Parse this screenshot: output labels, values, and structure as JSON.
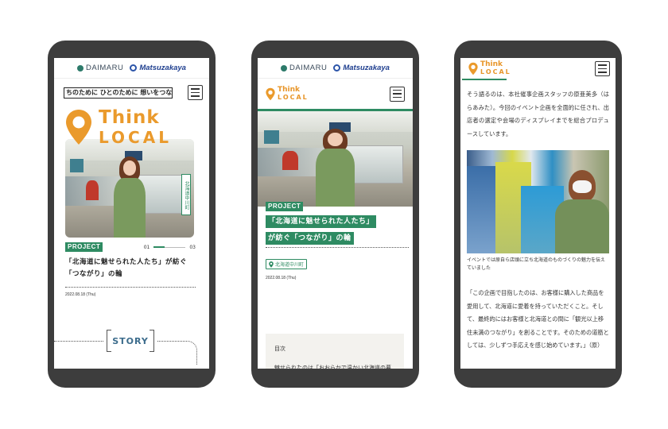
{
  "brand": {
    "daimaru": "DAIMARU",
    "matsuzakaya": "Matsuzakaya",
    "logo_line1": "Think",
    "logo_line2": "LOCAL"
  },
  "colors": {
    "accent_green": "#2e8b62",
    "logo_orange": "#ea9a2c",
    "story_blue": "#3c6c8c",
    "frame": "#3d3d3d"
  },
  "phone1": {
    "marquee": "ちのために ひとのために 想いをつな",
    "location_tag": "北海道中川町",
    "category": "PROJECT",
    "pager": {
      "current": "01",
      "total": "03",
      "progress": 0.33
    },
    "title": "「北海道に魅せられた人たち」が紡ぐ「つながり」の輪",
    "date": "2022.08.18 (Thu)",
    "section_label": "STORY"
  },
  "phone2": {
    "category": "PROJECT",
    "title_line1": "「北海道に魅せられた人たち」",
    "title_line2": "が紡ぐ「つながり」の輪",
    "location_tag": "北海道中川町",
    "date": "2022.08.18 (Thu)",
    "toc": {
      "heading": "目次",
      "item1": "魅せられたのは「おおらかで温かい北海道の暮らし」"
    }
  },
  "phone3": {
    "paragraph1": "そう語るのは、本社催事企画スタッフの原亜美多（はらあみた）。今回のイベント企画を全面的に任され、出店者の選定や会場のディスプレイまでを総合プロデュースしています。",
    "caption": "イベントでは原自ら店頭に立ち北海道のものづくりの魅力を伝えていました",
    "quote": "「この企画で目指したのは、お客様に購入した商品を愛用して、北海道に愛着を持っていただくこと。そして、最終的にはお客様と北海道との間に「観光以上移住未満のつながり」を創ることです。そのための道筋としては、少しずつ手応えを感じ始めています。」（原）"
  }
}
